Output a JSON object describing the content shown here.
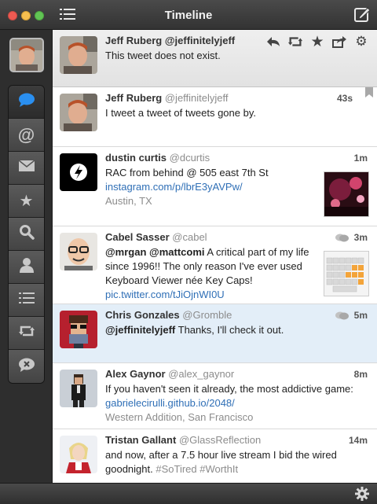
{
  "window": {
    "title": "Timeline"
  },
  "sidebar": {
    "items": [
      {
        "name": "timeline",
        "icon": "speech-bubble-icon",
        "active": true
      },
      {
        "name": "mentions",
        "icon": "at-sign-icon"
      },
      {
        "name": "messages",
        "icon": "envelope-icon"
      },
      {
        "name": "favorites",
        "icon": "star-icon"
      },
      {
        "name": "search",
        "icon": "magnifier-icon"
      },
      {
        "name": "profile",
        "icon": "person-icon"
      },
      {
        "name": "lists",
        "icon": "list-icon"
      },
      {
        "name": "retweets",
        "icon": "retweet-icon"
      },
      {
        "name": "mutes",
        "icon": "mute-icon"
      }
    ]
  },
  "tweets": [
    {
      "name": "Jeff Ruberg",
      "handle": "@jeffinitelyjeff",
      "text": "This tweet does not exist.",
      "time": ""
    },
    {
      "name": "Jeff Ruberg",
      "handle": "@jeffinitelyjeff",
      "text": "I tweet a tweet of tweets gone by.",
      "time": "43s"
    },
    {
      "name": "dustin curtis",
      "handle": "@dcurtis",
      "text": "RAC from behind @ 505 east 7th St",
      "link": "instagram.com/p/lbrE3yAVPw/",
      "place": "Austin, TX",
      "time": "1m"
    },
    {
      "name": "Cabel Sasser",
      "handle": "@cabel",
      "mention1": "@mrgan",
      "mention2": "@mattcomi",
      "text": "A critical part of my life since 1996!! The only reason I've ever used Keyboard Viewer née Key Caps!",
      "link": "pic.twitter.com/tJiOjnWI0U",
      "time": "3m"
    },
    {
      "name": "Chris Gonzales",
      "handle": "@Gromble",
      "mention1": "@jeffinitelyjeff",
      "text": "Thanks, I'll check it out.",
      "time": "5m"
    },
    {
      "name": "Alex Gaynor",
      "handle": "@alex_gaynor",
      "text": "If you haven't seen it already, the most addictive game:",
      "link": "gabrielecirulli.github.io/2048/",
      "place": "Western Addition, San Francisco",
      "time": "8m"
    },
    {
      "name": "Tristan Gallant",
      "handle": "@GlassReflection",
      "text": "and now, after a 7.5 hour live stream I bid the wired goodnight.",
      "tags": "#SoTired #WorthIt",
      "time": "14m"
    }
  ],
  "colors": {
    "link": "#2f6fb6",
    "handle": "#8c8c8c",
    "highlight_row": "#e3eef8",
    "titlebar": "#3a3a3a"
  }
}
